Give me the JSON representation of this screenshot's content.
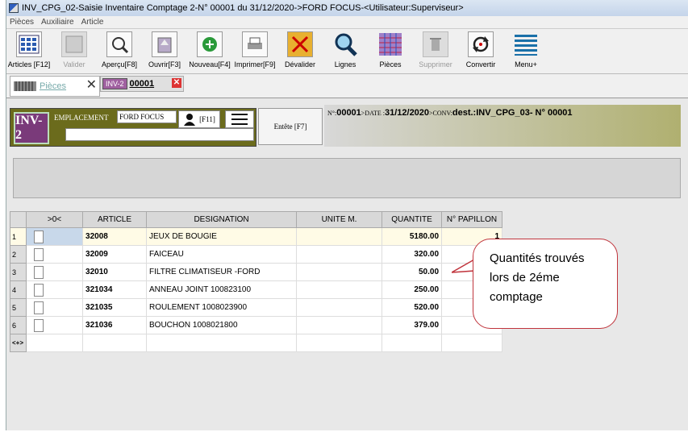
{
  "window": {
    "title": "INV_CPG_02-Saisie Inventaire Comptage 2-N° 00001 du 31/12/2020->FORD FOCUS-<Utilisateur:Superviseur>"
  },
  "menu": [
    "Pièces",
    "Auxiliaire",
    "Article"
  ],
  "toolbar": [
    {
      "label": "Articles [F12]",
      "icon": "articles-grid-icon",
      "enabled": true
    },
    {
      "label": "Valider",
      "icon": "validate-icon",
      "enabled": false
    },
    {
      "label": "Aperçu[F8]",
      "icon": "preview-icon",
      "enabled": true
    },
    {
      "label": "Ouvrir[F3]",
      "icon": "open-icon",
      "enabled": true
    },
    {
      "label": "Nouveau[F4]",
      "icon": "new-icon",
      "enabled": true
    },
    {
      "label": "Imprimer[F9]",
      "icon": "print-icon",
      "enabled": true
    },
    {
      "label": "Dévalider",
      "icon": "unvalidate-icon",
      "enabled": true
    },
    {
      "label": "Lignes",
      "icon": "search-icon",
      "enabled": true
    },
    {
      "label": "Pièces",
      "icon": "pieces-icon",
      "enabled": true
    },
    {
      "label": "Supprimer",
      "icon": "delete-icon",
      "enabled": false
    },
    {
      "label": "Convertir",
      "icon": "convert-icon",
      "enabled": true
    },
    {
      "label": "Menu+",
      "icon": "menu-icon",
      "enabled": true
    }
  ],
  "tabs": {
    "pieces_label": "Pièces",
    "doc_logo": "INV-2",
    "doc_label": "00001"
  },
  "header": {
    "logo_text": "INV-2",
    "emplacement_label": "EMPLACEMENT",
    "emplacement_value": "FORD FOCUS",
    "user_shortcut": "[F11]",
    "entete_label": "Entête [F7]",
    "info": {
      "n_label": "N°:",
      "n_value": "00001",
      "date_label": ">DATE :",
      "date_value": "31/12/2020",
      "conv_label": ">CONV:",
      "conv_value": "dest.:INV_CPG_03- N° 00001"
    }
  },
  "grid": {
    "columns": [
      ">0<",
      "ARTICLE",
      "DESIGNATION",
      "UNITE M.",
      "QUANTITE",
      "N° PAPILLON"
    ],
    "rows": [
      {
        "num": "1",
        "article": "32008",
        "designation": "JEUX DE BOUGIE",
        "unit": "",
        "qty": "5180.00",
        "papillon": "1"
      },
      {
        "num": "2",
        "article": "32009",
        "designation": "FAICEAU",
        "unit": "",
        "qty": "320.00",
        "papillon": ""
      },
      {
        "num": "3",
        "article": "32010",
        "designation": "FILTRE CLIMATISEUR -FORD",
        "unit": "",
        "qty": "50.00",
        "papillon": ""
      },
      {
        "num": "4",
        "article": "321034",
        "designation": "ANNEAU JOINT 100823100",
        "unit": "",
        "qty": "250.00",
        "papillon": ""
      },
      {
        "num": "5",
        "article": "321035",
        "designation": "ROULEMENT 1008023900",
        "unit": "",
        "qty": "520.00",
        "papillon": ""
      },
      {
        "num": "6",
        "article": "321036",
        "designation": "BOUCHON 1008021800",
        "unit": "",
        "qty": "379.00",
        "papillon": ""
      }
    ],
    "new_row_marker": "<+>"
  },
  "callout": {
    "line1": "Quantités trouvés",
    "line2": "lors de 2éme",
    "line3": "comptage"
  }
}
